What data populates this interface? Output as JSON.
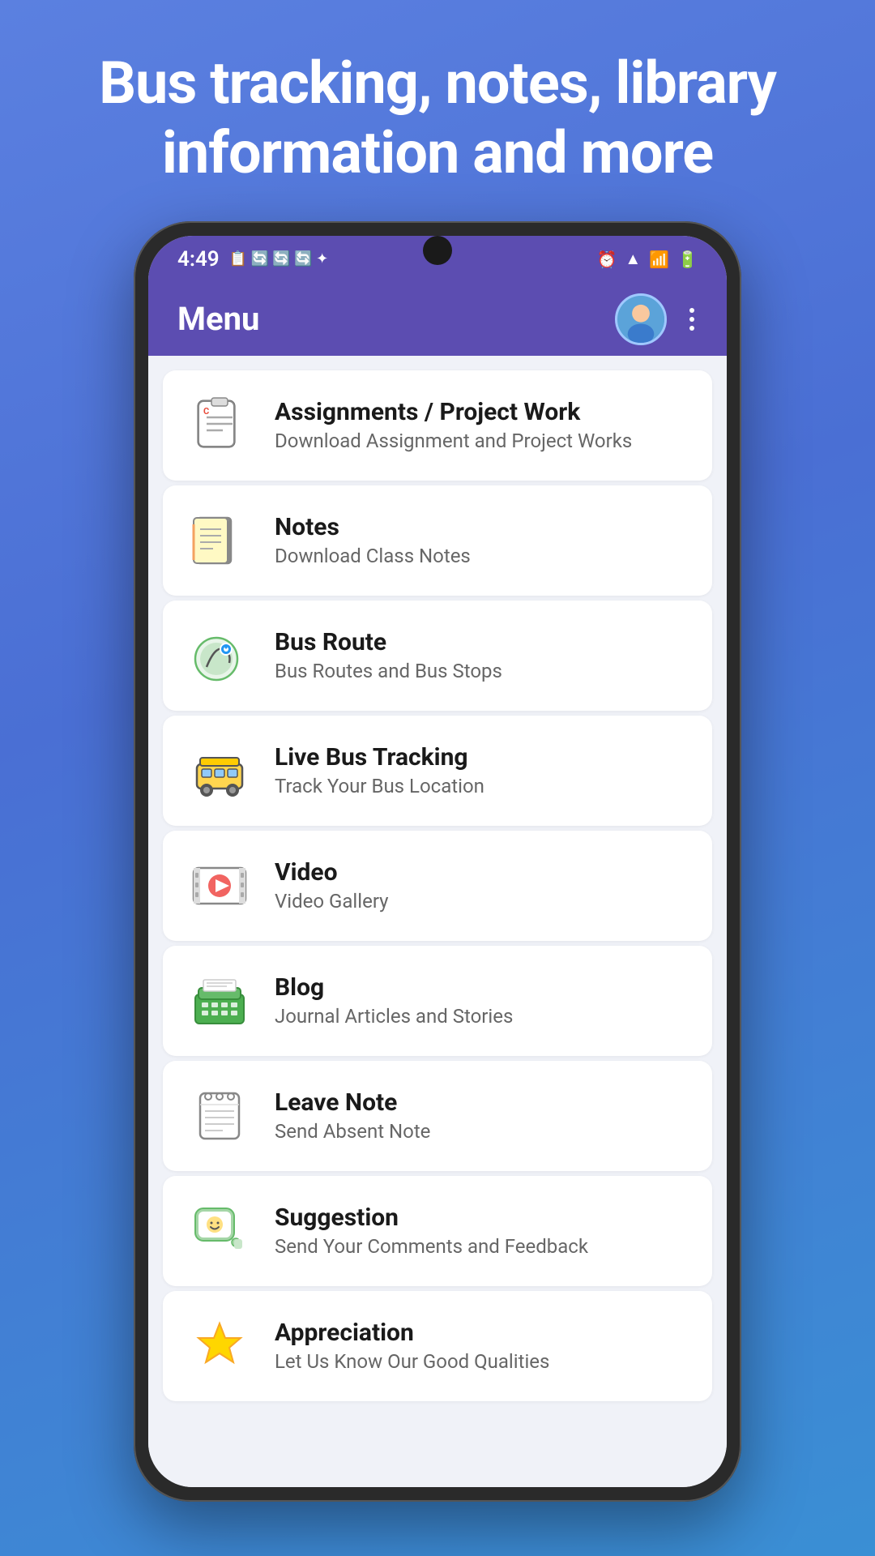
{
  "hero": {
    "title": "Bus tracking, notes, library information and more"
  },
  "statusBar": {
    "time": "4:49",
    "icons": [
      "📋",
      "🔄",
      "🔄",
      "🔄",
      "✦",
      "⏰",
      "📶",
      "📶",
      "🔋"
    ]
  },
  "appBar": {
    "title": "Menu",
    "moreLabel": "⋮"
  },
  "menuItems": [
    {
      "id": "assignments",
      "title": "Assignments / Project Work",
      "subtitle": "Download Assignment and Project Works",
      "iconType": "assignments"
    },
    {
      "id": "notes",
      "title": "Notes",
      "subtitle": "Download Class Notes",
      "iconType": "notes"
    },
    {
      "id": "bus-route",
      "title": "Bus Route",
      "subtitle": "Bus Routes and Bus Stops",
      "iconType": "busroute"
    },
    {
      "id": "live-bus",
      "title": "Live Bus Tracking",
      "subtitle": "Track Your Bus Location",
      "iconType": "livebus"
    },
    {
      "id": "video",
      "title": "Video",
      "subtitle": "Video Gallery",
      "iconType": "video"
    },
    {
      "id": "blog",
      "title": "Blog",
      "subtitle": "Journal Articles and Stories",
      "iconType": "blog"
    },
    {
      "id": "leave-note",
      "title": "Leave Note",
      "subtitle": "Send Absent Note",
      "iconType": "leavenote"
    },
    {
      "id": "suggestion",
      "title": "Suggestion",
      "subtitle": "Send Your Comments and Feedback",
      "iconType": "suggestion"
    },
    {
      "id": "appreciation",
      "title": "Appreciation",
      "subtitle": "Let Us Know Our Good Qualities",
      "iconType": "appreciation"
    }
  ]
}
